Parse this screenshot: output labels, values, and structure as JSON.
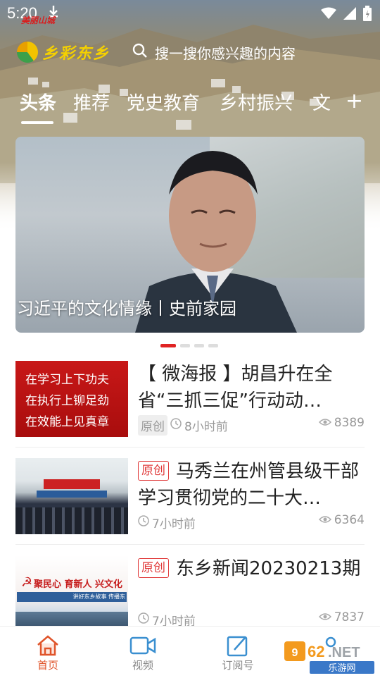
{
  "status": {
    "time": "5:20"
  },
  "header": {
    "top_label": "美丽山城",
    "logo_text": "乡彩东乡",
    "search_placeholder": "搜一搜你感兴趣的内容",
    "tabs": [
      "头条",
      "推荐",
      "党史教育",
      "乡村振兴",
      "文"
    ],
    "add_tab": "+"
  },
  "banner": {
    "caption": "习近平的文化情缘丨史前家园",
    "pages": 4,
    "active_page": 0
  },
  "feed": [
    {
      "title_prefix": "",
      "title": "【 微海报 】胡昌升在全省“三抓三促”行动动…",
      "thumb_lines": [
        "在学习上下功夫",
        "在执行上铆足劲",
        "在效能上见真章"
      ],
      "badge": "原创",
      "time": "8小时前",
      "views": "8389"
    },
    {
      "title_badge": "原创",
      "title": "马秀兰在州管县级干部学习贯彻党的二十大…",
      "time": "7小时前",
      "views": "6364"
    },
    {
      "title_badge": "原创",
      "title": "东乡新闻20230213期",
      "thumb_text": "聚民心 育新人 兴文化",
      "thumb_sub": "讲好东乡故事 传播东",
      "time": "7小时前",
      "views": "7837"
    }
  ],
  "bottom_nav": [
    {
      "label": "首页",
      "icon": "home-icon"
    },
    {
      "label": "视频",
      "icon": "video-icon"
    },
    {
      "label": "订阅号",
      "icon": "subscribe-icon"
    },
    {
      "label": "",
      "icon": "profile-icon"
    }
  ],
  "watermark": "962.NET 乐游网",
  "colors": {
    "accent": "#e0542a",
    "red": "#e02323",
    "logo_yellow": "#f5d100"
  }
}
